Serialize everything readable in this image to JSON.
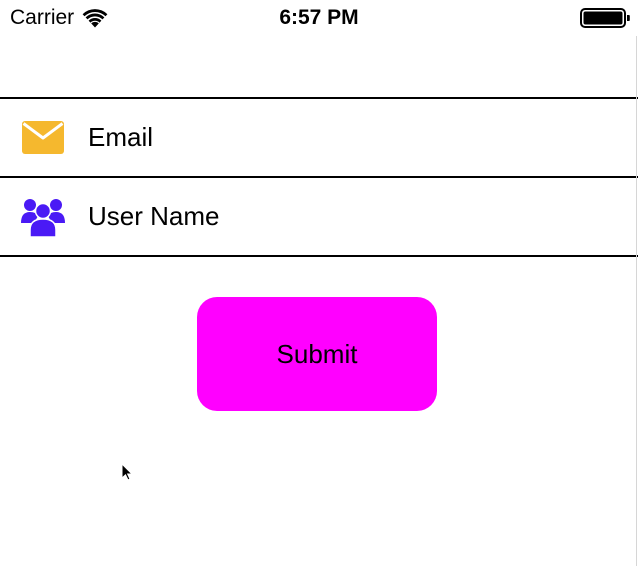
{
  "status_bar": {
    "carrier": "Carrier",
    "time": "6:57 PM",
    "wifi_icon": "wifi-icon",
    "battery_icon": "battery-icon"
  },
  "form": {
    "email": {
      "icon": "envelope-icon",
      "icon_color": "#F5B82E",
      "placeholder": "Email",
      "value": ""
    },
    "username": {
      "icon": "users-group-icon",
      "icon_color": "#4A1AF5",
      "placeholder": "User Name",
      "value": ""
    }
  },
  "submit": {
    "label": "Submit",
    "background_color": "#FF00FF"
  },
  "cursor": {
    "icon": "mouse-pointer-icon"
  }
}
